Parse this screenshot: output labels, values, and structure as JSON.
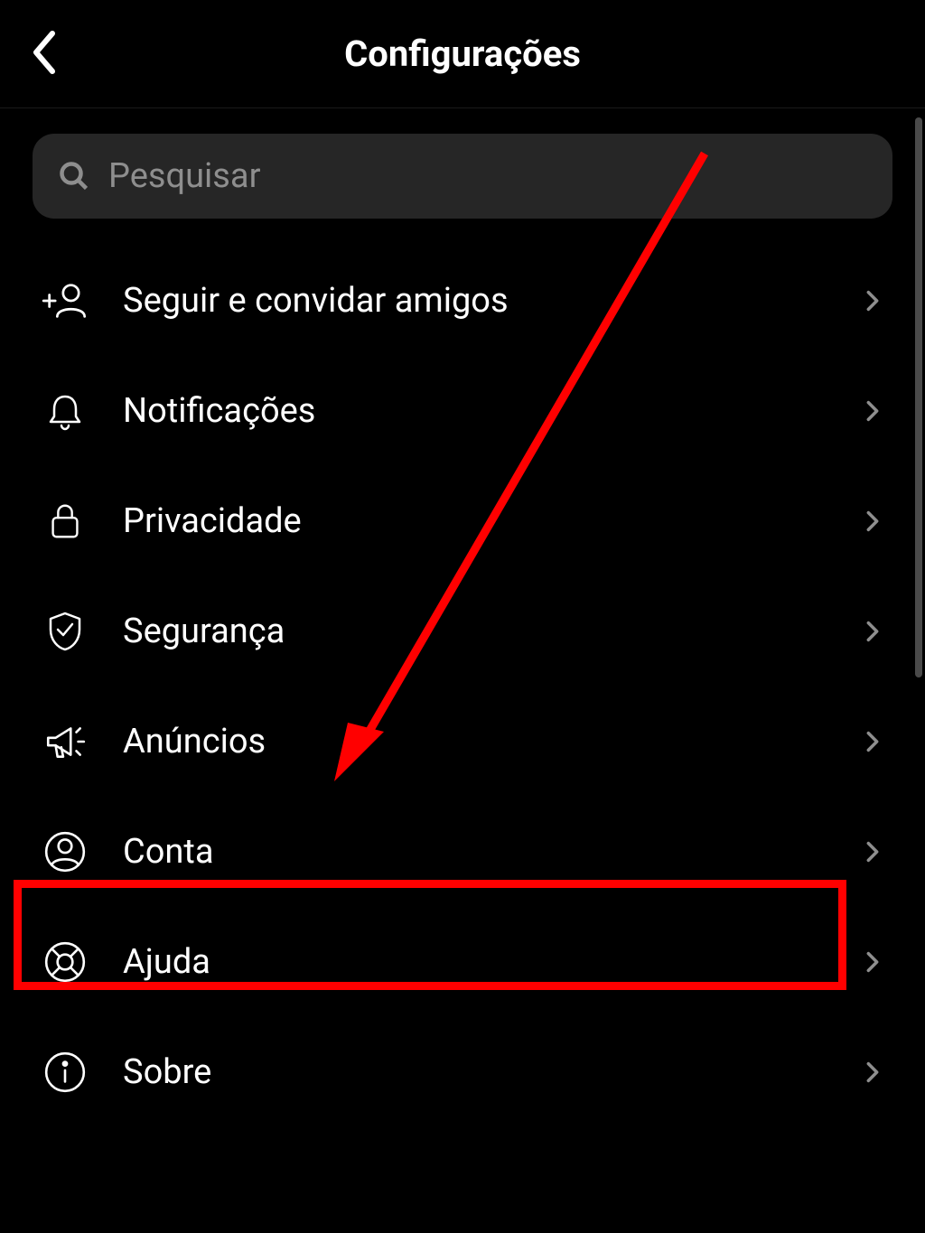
{
  "header": {
    "title": "Configurações"
  },
  "search": {
    "placeholder": "Pesquisar"
  },
  "menu": {
    "items": [
      {
        "label": "Seguir e convidar amigos",
        "icon": "add-person"
      },
      {
        "label": "Notificações",
        "icon": "bell"
      },
      {
        "label": "Privacidade",
        "icon": "lock"
      },
      {
        "label": "Segurança",
        "icon": "shield-check"
      },
      {
        "label": "Anúncios",
        "icon": "megaphone"
      },
      {
        "label": "Conta",
        "icon": "account"
      },
      {
        "label": "Ajuda",
        "icon": "help-ring"
      },
      {
        "label": "Sobre",
        "icon": "info"
      }
    ]
  },
  "annotation": {
    "highlighted_item_index": 5
  }
}
